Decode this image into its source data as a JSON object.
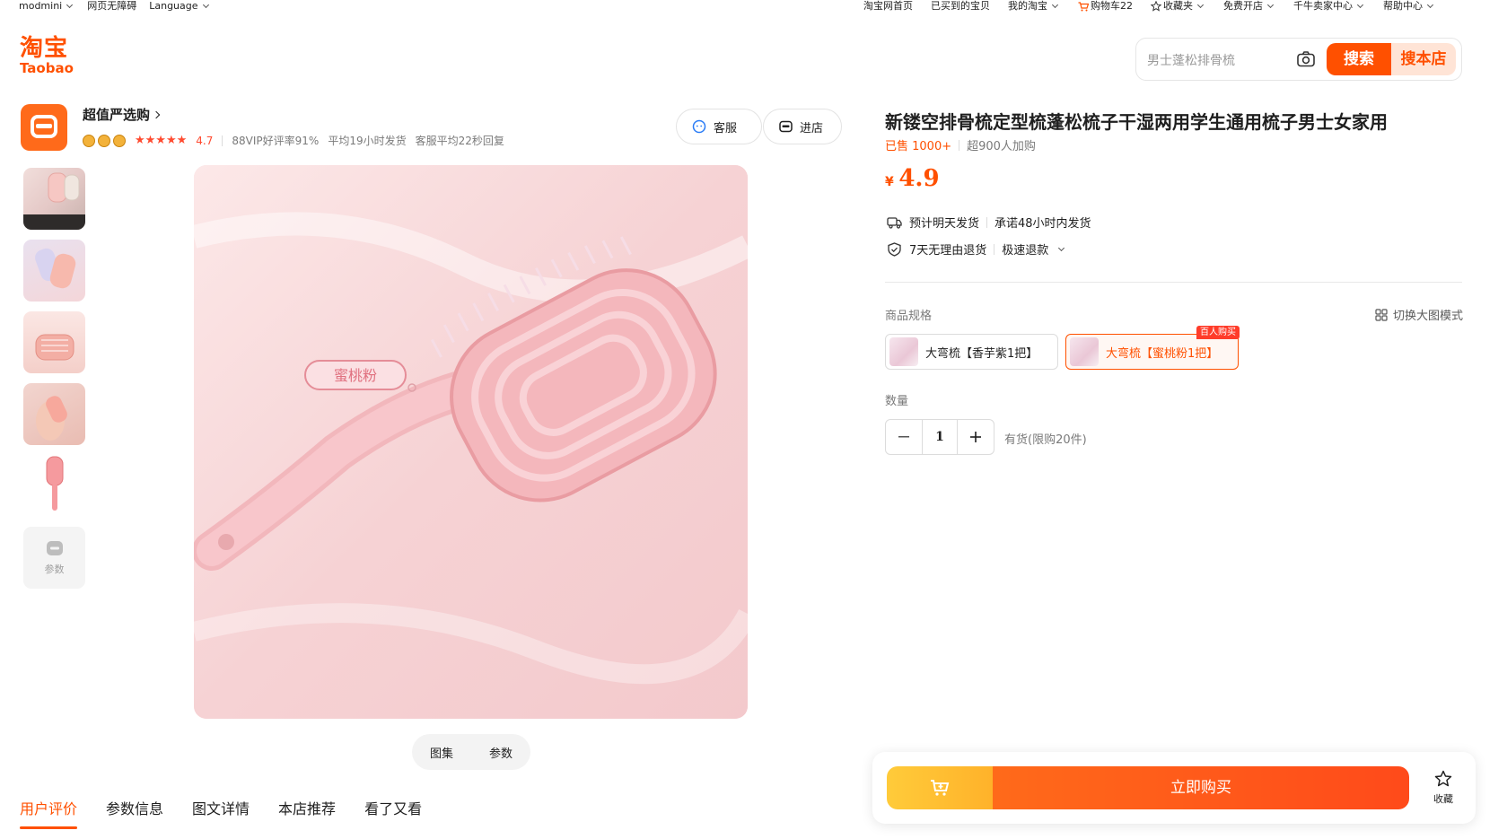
{
  "topnav": {
    "left": [
      "modmini",
      "网页无障碍",
      "Language"
    ],
    "right": [
      "淘宝网首页",
      "已买到的宝贝",
      "我的淘宝",
      "购物车22",
      "收藏夹",
      "免费开店",
      "千牛卖家中心",
      "帮助中心"
    ]
  },
  "logo": {
    "cn": "淘宝",
    "en": "Taobao"
  },
  "search": {
    "placeholder": "男士蓬松排骨梳",
    "btn_search": "搜索",
    "btn_store": "搜本店"
  },
  "shop": {
    "name": "超值严选购",
    "score": "4.7",
    "meta": [
      "88VIP好评率91%",
      "平均19小时发货",
      "客服平均22秒回复"
    ],
    "btn_service": "客服",
    "btn_store": "进店"
  },
  "gallery": {
    "params_label": "参数",
    "overlay_label": "蜜桃粉",
    "toggle": [
      "图集",
      "参数"
    ]
  },
  "tabs": [
    "用户评价",
    "参数信息",
    "图文详情",
    "本店推荐",
    "看了又看"
  ],
  "product": {
    "title": "新镂空排骨梳定型梳蓬松梳子干湿两用学生通用梳子男士女家用",
    "sold": "已售 1000+",
    "joined": "超900人加购",
    "currency": "¥",
    "price": "4.9",
    "ship_1": "预计明天发货",
    "ship_2": "承诺48小时内发货",
    "return_1": "7天无理由退货",
    "return_2": "极速退款",
    "spec_label": "商品规格",
    "switch_label": "切换大图模式",
    "skus": [
      {
        "label": "大弯梳【香芋紫1把】"
      },
      {
        "label": "大弯梳【蜜桃粉1把】",
        "badge": "百人购买"
      }
    ],
    "qty_label": "数量",
    "qty": "1",
    "stock": "有货(限购20件)"
  },
  "buybar": {
    "buy": "立即购买",
    "fav": "收藏"
  },
  "colors": {
    "accent": "#ff5000",
    "image_bg": "#f8d6d8"
  }
}
